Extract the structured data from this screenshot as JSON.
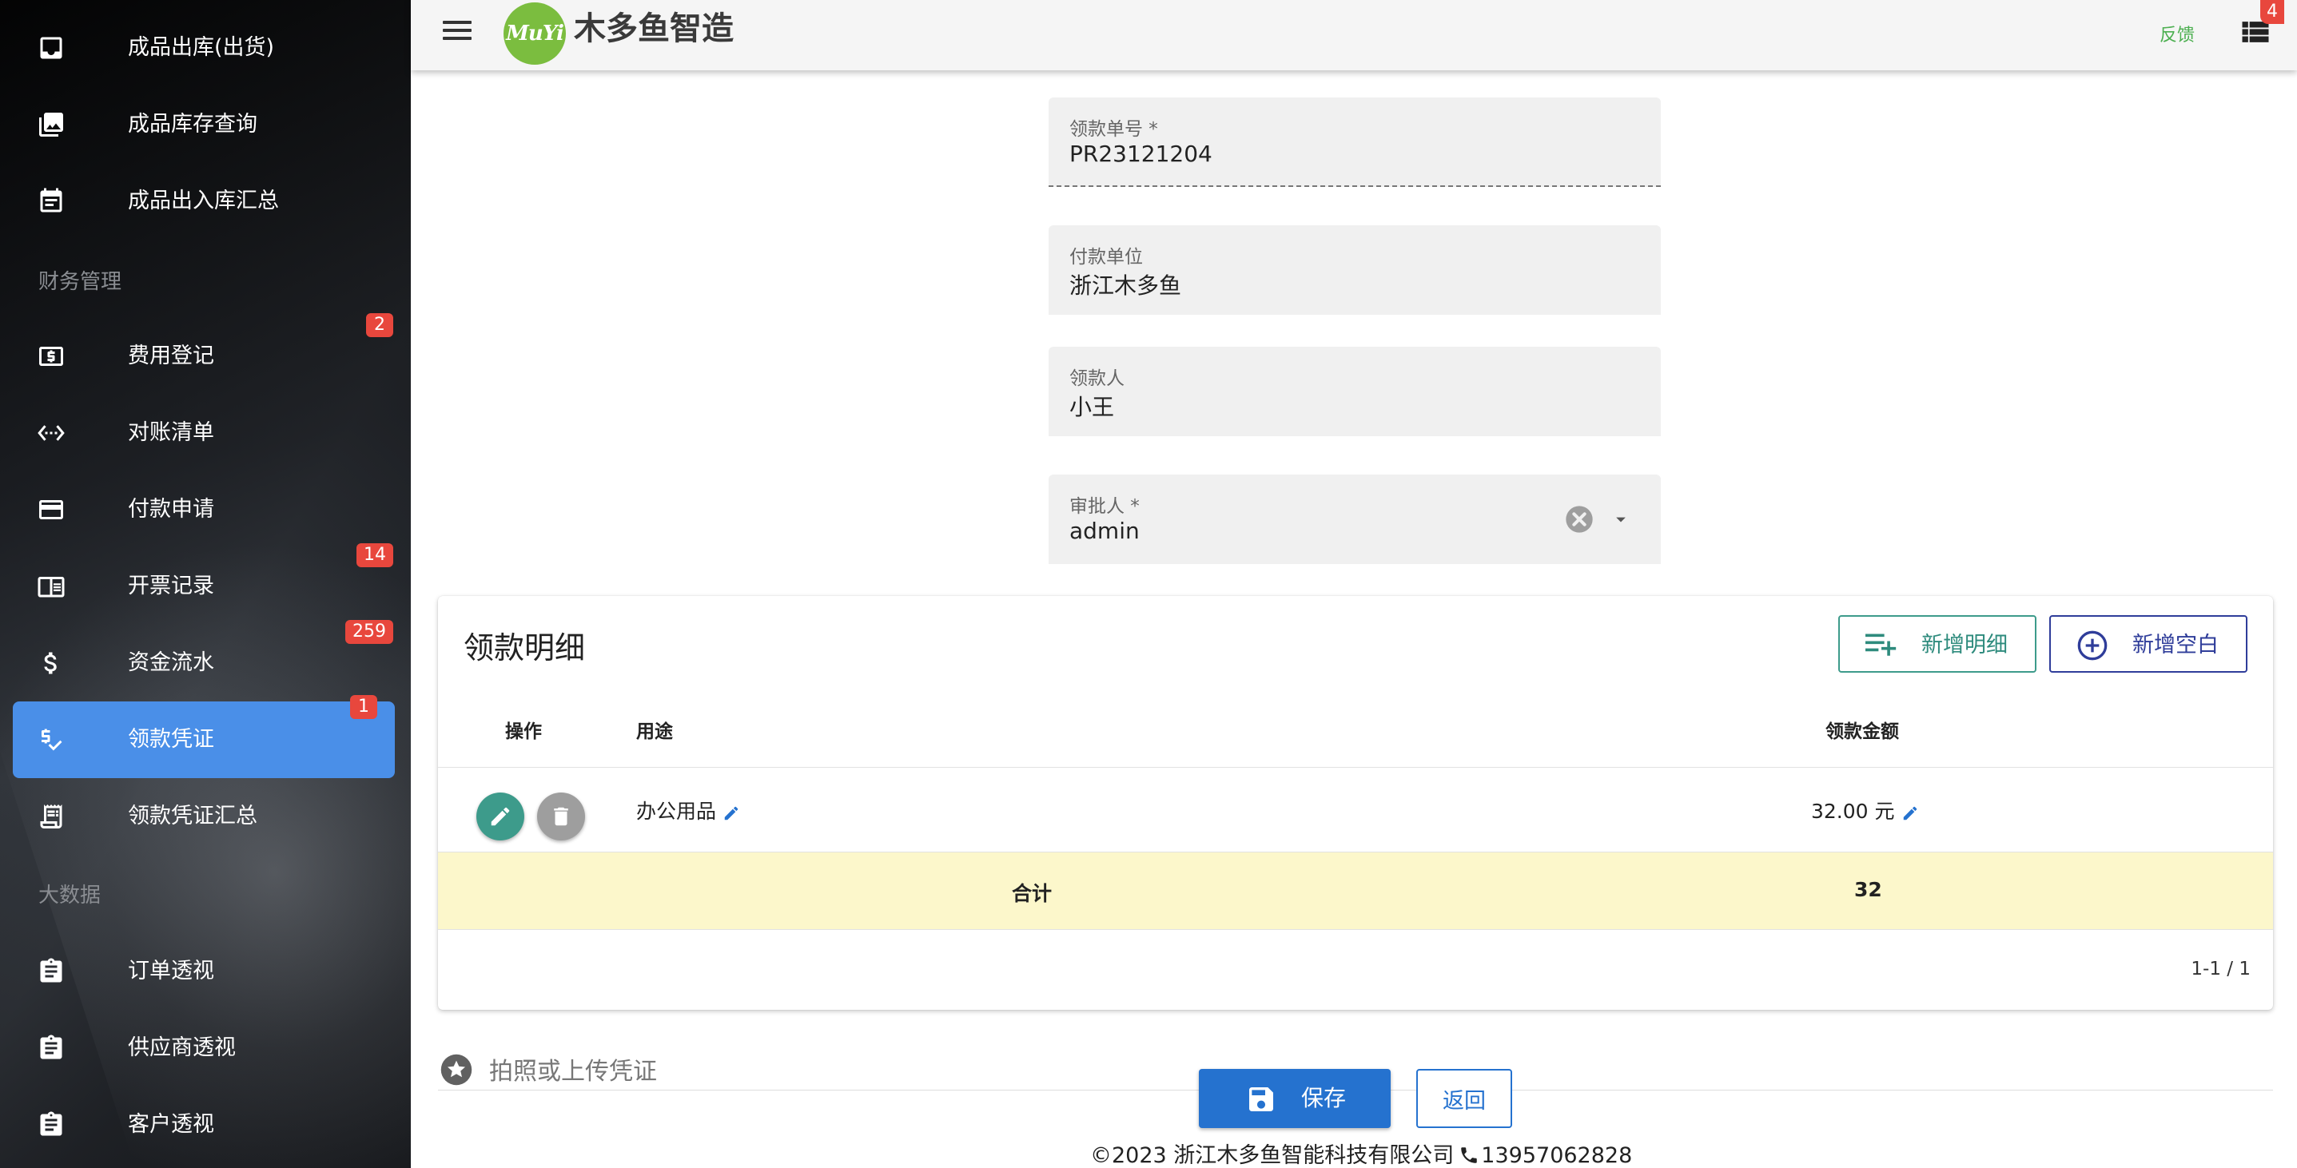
{
  "sidebar": {
    "items": [
      {
        "label": "成品出库(出货)",
        "icon": "inbox-icon"
      },
      {
        "label": "成品库存查询",
        "icon": "photo-library-icon"
      },
      {
        "label": "成品出入库汇总",
        "icon": "calendar-note-icon"
      },
      {
        "label": "费用登记",
        "icon": "money-box-icon",
        "badge": "2"
      },
      {
        "label": "对账清单",
        "icon": "settings-ethernet-icon"
      },
      {
        "label": "付款申请",
        "icon": "credit-card-icon"
      },
      {
        "label": "开票记录",
        "icon": "receipt-book-icon",
        "badge": "14"
      },
      {
        "label": "资金流水",
        "icon": "dollar-icon",
        "badge": "259"
      },
      {
        "label": "领款凭证",
        "icon": "price-check-icon",
        "badge": "1",
        "active": true
      },
      {
        "label": "领款凭证汇总",
        "icon": "receipt-long-icon"
      },
      {
        "label": "订单透视",
        "icon": "clipboard-icon"
      },
      {
        "label": "供应商透视",
        "icon": "clipboard-icon"
      },
      {
        "label": "客户透视",
        "icon": "clipboard-icon"
      }
    ],
    "sections": {
      "finance": "财务管理",
      "bigdata": "大数据"
    }
  },
  "topbar": {
    "logo_text": "MuYi",
    "brand": "木多鱼智造",
    "feedback": "反馈",
    "list_badge": "4"
  },
  "form": {
    "receipt_no_label": "领款单号 *",
    "receipt_no_value": "PR23121204",
    "payer_label": "付款单位",
    "payer_value": "浙江木多鱼",
    "receiver_label": "领款人",
    "receiver_value": "小王",
    "approver_label": "审批人 *",
    "approver_value": "admin"
  },
  "detail": {
    "title": "领款明细",
    "add_detail_label": "新增明细",
    "add_blank_label": "新增空白",
    "columns": {
      "action": "操作",
      "purpose": "用途",
      "amount": "领款金额"
    },
    "rows": [
      {
        "purpose": "办公用品",
        "amount": "32.00 元"
      }
    ],
    "total_label": "合计",
    "total_value": "32",
    "pagination": "1-1 / 1"
  },
  "upload": {
    "label": "拍照或上传凭证"
  },
  "actions": {
    "save_label": "保存",
    "back_label": "返回"
  },
  "footer": {
    "copyright": "©2023 浙江木多鱼智能科技有限公司",
    "phone": "13957062828"
  },
  "colors": {
    "sidebar_active": "#4a8fe8",
    "badge": "#e8473d",
    "primary": "#2572cf",
    "teal": "#3d9b8b",
    "indigo": "#2f3d9a",
    "total_row": "#fcf7cb",
    "logo": "#7bbd3f"
  }
}
